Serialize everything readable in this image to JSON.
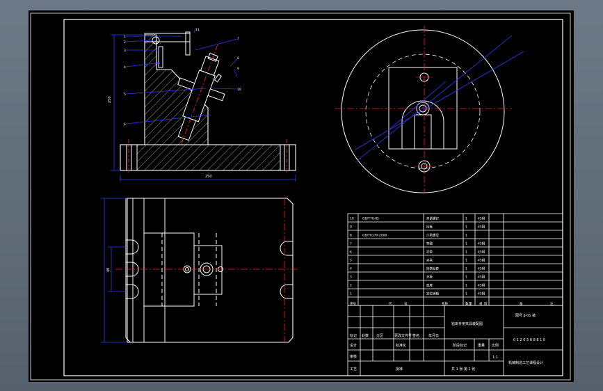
{
  "dims": {
    "front_height": "250",
    "front_width": "250",
    "top_height": "40"
  },
  "balloons": [
    "1",
    "2",
    "3",
    "4",
    "5",
    "6",
    "7",
    "8",
    "9",
    "10",
    "11"
  ],
  "parts_list": {
    "rows": [
      {
        "no": "10",
        "code": "GB/T70-85",
        "name": "夹紧螺钉",
        "qty": "1",
        "material": "45钢"
      },
      {
        "no": "9",
        "code": "",
        "name": "压板",
        "qty": "1",
        "material": "45钢"
      },
      {
        "no": "8",
        "code": "GB/T6170-2000",
        "name": "六角螺母",
        "qty": "1",
        "material": ""
      },
      {
        "no": "7",
        "code": "",
        "name": "垫圈",
        "qty": "1",
        "material": "45钢"
      },
      {
        "no": "6",
        "code": "",
        "name": "衬套",
        "qty": "1",
        "material": "45钢"
      },
      {
        "no": "5",
        "code": "",
        "name": "夹具",
        "qty": "1",
        "material": "45钢"
      },
      {
        "no": "4",
        "code": "",
        "name": "快换钻套",
        "qty": "1",
        "material": "45钢"
      },
      {
        "no": "3",
        "code": "",
        "name": "支板",
        "qty": "1",
        "material": "45钢"
      },
      {
        "no": "2",
        "code": "",
        "name": "底座",
        "qty": "1",
        "material": "45钢"
      },
      {
        "no": "1",
        "code": "",
        "name": "定位销轴",
        "qty": "1",
        "material": "45钢"
      }
    ],
    "header": {
      "no": "序号",
      "code": "代",
      "code2": "号",
      "name": "名称",
      "qty": "数",
      "qty2": "量",
      "material": "材",
      "material2": "料",
      "mass_a": "备",
      "mass_b": "注"
    }
  },
  "title_block": {
    "company_title": "钻床专用夹具装配图",
    "drawing_no": "图号 JJ-01 装",
    "digits": "0 1 2 0 5 8 8 8 1 0",
    "school": "机械制造工艺课程设计",
    "scale": "1:1",
    "sheet": "共 1 张 第 1 张",
    "labels": {
      "mark": "标记",
      "count": "处数",
      "zone": "分区",
      "change_doc": "更改文件号",
      "sign": "签名",
      "date": "年月日",
      "design": "设计",
      "standard": "标准化",
      "stage": "阶段标记",
      "weight": "重量",
      "ratio": "比例",
      "review": "审核",
      "process": "工艺",
      "approve": "批准"
    }
  },
  "colors": {
    "background": "#000000",
    "geometry": "#ffffff",
    "centerline": "#ff2020",
    "dimension": "#2a3cff",
    "hatch": "#ffffff",
    "chrome": "#5f6b78"
  }
}
